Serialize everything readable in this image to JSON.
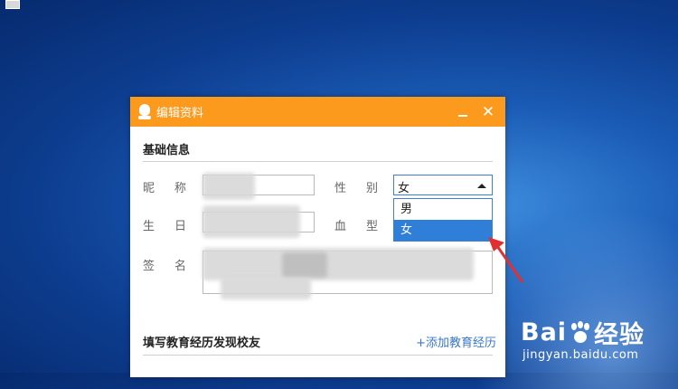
{
  "dialog": {
    "title": "编辑资料",
    "minimize_glyph": "",
    "close_glyph": "✕",
    "sections": {
      "basic": "基础信息",
      "education": "填写教育经历发现校友",
      "add_education": "+添加教育经历"
    },
    "fields": {
      "nickname_label": "昵称",
      "gender_label": "性别",
      "birthday_label": "生日",
      "blood_label": "血型",
      "signature_label": "签名"
    },
    "gender": {
      "selected": "女",
      "options": [
        "男",
        "女"
      ],
      "highlighted_index": 1
    }
  },
  "watermark": {
    "brand_left": "Bai",
    "brand_right": "经验",
    "url": "jingyan.baidu.com"
  },
  "colors": {
    "titlebar": "#fb9a1c",
    "accent": "#2f7fd8",
    "link": "#3778c9",
    "arrow": "#e03030"
  }
}
